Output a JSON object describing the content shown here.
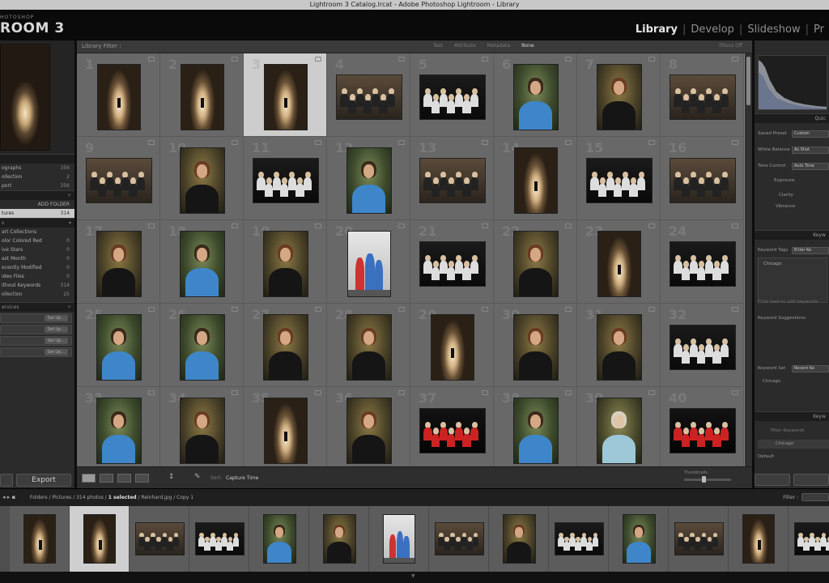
{
  "window_title": "Lightroom 3 Catalog.lrcat - Adobe Photoshop Lightroom - Library",
  "brand": {
    "small": "HOTOSHOP",
    "name": "ROOM 3"
  },
  "modules": [
    "Library",
    "Develop",
    "Slideshow",
    "Pr"
  ],
  "active_module": "Library",
  "left_panel": {
    "catalog_rows": [
      {
        "label": "ographs",
        "count": "356"
      },
      {
        "label": "ollection",
        "count": "2"
      },
      {
        "label": "port",
        "count": "356"
      }
    ],
    "folders_header": "ADD FOLDER",
    "folder_rows": [
      {
        "label": "tures",
        "count": "314"
      }
    ],
    "collections_header": "s",
    "collection_rows": [
      {
        "label": "art Collections",
        "count": ""
      },
      {
        "label": "olor Colored Red",
        "count": "0"
      },
      {
        "label": "ive Stars",
        "count": "0"
      },
      {
        "label": "ast Month",
        "count": "0"
      },
      {
        "label": "ecently Modified",
        "count": "0"
      },
      {
        "label": "ideo Files",
        "count": "0"
      },
      {
        "label": "ithout Keywords",
        "count": "314"
      },
      {
        "label": "ollection",
        "count": "25"
      }
    ],
    "publish_header": "ervices",
    "publish_rows": [
      {
        "label": "",
        "btn": "Set Up..."
      },
      {
        "label": "",
        "btn": "Set Up..."
      },
      {
        "label": "",
        "btn": "Set Up..."
      },
      {
        "label": "",
        "btn": "Set Up..."
      }
    ],
    "export_label": "Export"
  },
  "filter_bar": {
    "title": "Library Filter :",
    "tabs": [
      "Text",
      "Attribute",
      "Metadata",
      "None"
    ],
    "active_tab": "None",
    "preset": "Filters Off"
  },
  "grid": {
    "columns": 8,
    "first_number": 1,
    "selected_index": 2,
    "cells": [
      "t",
      "t",
      "t",
      "g",
      "s",
      "b",
      "p",
      "g",
      "g",
      "p",
      "s",
      "b",
      "g",
      "t",
      "s",
      "g",
      "p",
      "b",
      "p",
      "w",
      "s",
      "p",
      "t",
      "s",
      "b",
      "b",
      "p",
      "p",
      "t",
      "p",
      "p",
      "s",
      "b",
      "p",
      "t",
      "p",
      "r",
      "b",
      "l",
      "r"
    ]
  },
  "toolbar": {
    "sort_label": "Sort:",
    "sort_value": "Capture Time",
    "thumbnails_label": "Thumbnails"
  },
  "right_panel": {
    "quick_develop_header": "Quic",
    "saved_preset": {
      "label": "Saved Preset",
      "value": "Custom"
    },
    "white_balance": {
      "label": "White Balance",
      "value": "As Shot"
    },
    "tone_control": {
      "label": "Tone Control",
      "value": "Auto Tone"
    },
    "tone_rows": [
      "Exposure",
      "Clarity",
      "Vibrance"
    ],
    "keywording_header": "Keyw",
    "keyword_tags": {
      "label": "Keyword Tags",
      "value": "Enter Ke"
    },
    "keyword_value": "Chicago",
    "keyword_hint": "Click here to add keywords",
    "keyword_suggestions": "Keyword Suggestions",
    "keyword_set": {
      "label": "Keyword Set",
      "value": "Recent Ke"
    },
    "keyword_set_item": "Chicago",
    "keyword_list_header": "Keyw",
    "keyword_filter": "Filter Keywords",
    "keyword_list_item": "Chicago",
    "default_label": "Default"
  },
  "filmstrip_bar": {
    "path_prefix": "Folders / Pictures / 314 photos /",
    "selected": "1 selected",
    "path_suffix": "/ Reinhard.jpg / Copy 1",
    "filter_label": "Filter :"
  },
  "filmstrip": {
    "selected_index": 1,
    "cells": [
      "t",
      "t",
      "g",
      "s",
      "b",
      "p",
      "w",
      "g",
      "p",
      "s",
      "b",
      "g",
      "t",
      "s"
    ]
  },
  "colors": {
    "panel_bg": "#2b2b2b",
    "grid_bg": "#7e7e7e",
    "cell_bg": "#686868",
    "cell_selected": "#cdcdcd",
    "module_active": "#e6e6e6"
  }
}
